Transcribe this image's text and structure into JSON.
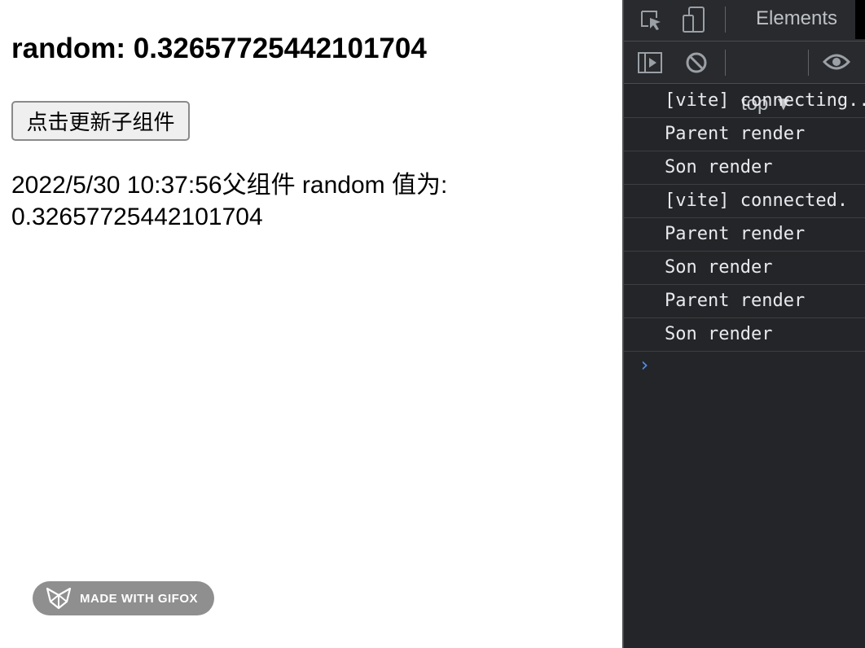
{
  "page": {
    "heading": "random: 0.32657725442101704",
    "button_label": "点击更新子组件",
    "info_text": "2022/5/30 10:37:56父组件 random 值为: 0.32657725442101704"
  },
  "watermark": {
    "label": "MADE WITH GIFOX",
    "icon": "gifox-fox-icon"
  },
  "devtools": {
    "tabs": [
      "Elements"
    ],
    "toolbar_icons": [
      "inspect-element-icon",
      "device-toolbar-icon",
      "sidebar-toggle-icon",
      "clear-console-icon",
      "eye-icon"
    ],
    "context": "top ▼",
    "console_messages": [
      "[vite] connecting...",
      "Parent render",
      "Son render",
      "[vite] connected.",
      "Parent render",
      "Son render",
      "Parent render",
      "Son render"
    ],
    "prompt": "›"
  },
  "colors": {
    "devtools_bg": "#242528",
    "devtools_toolbar": "#292a2d",
    "prompt_accent": "#4e90ef",
    "button_bg": "#efefef"
  }
}
